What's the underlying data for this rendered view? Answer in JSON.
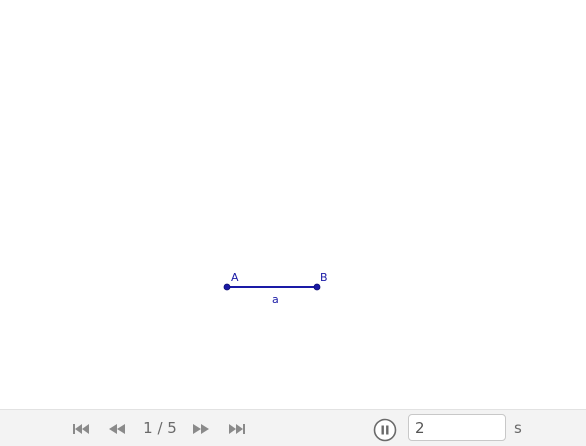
{
  "construction": {
    "point_a_label": "A",
    "point_b_label": "B",
    "segment_label": "a",
    "color": "#1a1aa6"
  },
  "toolbar": {
    "first_icon": "skip-to-start-icon",
    "prev_icon": "step-back-icon",
    "step_counter": "1 / 5",
    "next_icon": "step-forward-icon",
    "last_icon": "skip-to-end-icon",
    "pause_icon": "pause-icon",
    "speed_value": "2",
    "speed_unit": "s",
    "icon_color": "#8a8a8a"
  }
}
